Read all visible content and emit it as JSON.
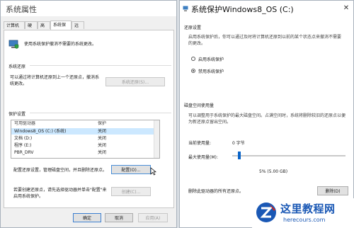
{
  "left_window": {
    "title": "系统属性",
    "tabs": [
      "计算机名",
      "硬件",
      "高级",
      "系统保护",
      "远程"
    ],
    "description": "使用系统保护撤消不需要的系统更改。",
    "restore_section": "系统还原",
    "restore_text": "可以通过将计算机还原到上一个还原点，撤消系统更改。",
    "restore_button": "系统还原(S)...",
    "protection_section": "保护设置",
    "columns": [
      "可用驱动器",
      "保护"
    ],
    "drives": [
      {
        "name": "Windows8_OS (C:) (系统)",
        "status": "关闭"
      },
      {
        "name": "文档 (D:)",
        "status": "关闭"
      },
      {
        "name": "程序 (E:)",
        "status": "关闭"
      },
      {
        "name": "PBR_DRV",
        "status": "关闭"
      }
    ],
    "config_text": "配置还原设置，管理磁盘空间，并且删除还原点。",
    "config_button": "配置(O)...",
    "create_text": "若要创建还原点，请先选择驱动器并单击\"配置\"来启用系统保护。",
    "create_button": "创建(C)...",
    "ok_button": "确定",
    "cancel_button": "取消",
    "apply_button": "应用(A)"
  },
  "right_window": {
    "title": "系统保护Windows8_OS (C:)",
    "restore_settings_section": "还原设置",
    "restore_settings_text": "启用系统保护后，你可以通过及时将计算机还原到以前的某个状态点来撤消不需要的更改。",
    "radio_enable": "启用系统保护",
    "radio_disable": "禁用系统保护",
    "disk_section": "磁盘空间使用量",
    "disk_text": "可以调整用于系统保护的最大磁盘空间。占满空间时，系统将删除较旧的还原点以便为新还原点留出空间。",
    "current_usage_label": "当前使用量:",
    "current_usage_value": "0 字节",
    "max_usage_label": "最大使用量(M):",
    "slider_readout": "5% (5.00 GB)",
    "slider_value_percent": 5,
    "delete_text": "删除此驱动器的所有还原点。",
    "delete_button": "删除(D)"
  },
  "watermark": {
    "text": "这里教程网",
    "url": "herecours.com"
  },
  "colors": {
    "selection": "#cce8ff",
    "watermark_blue": "#1a58b5",
    "watermark_red": "#d0261c"
  }
}
